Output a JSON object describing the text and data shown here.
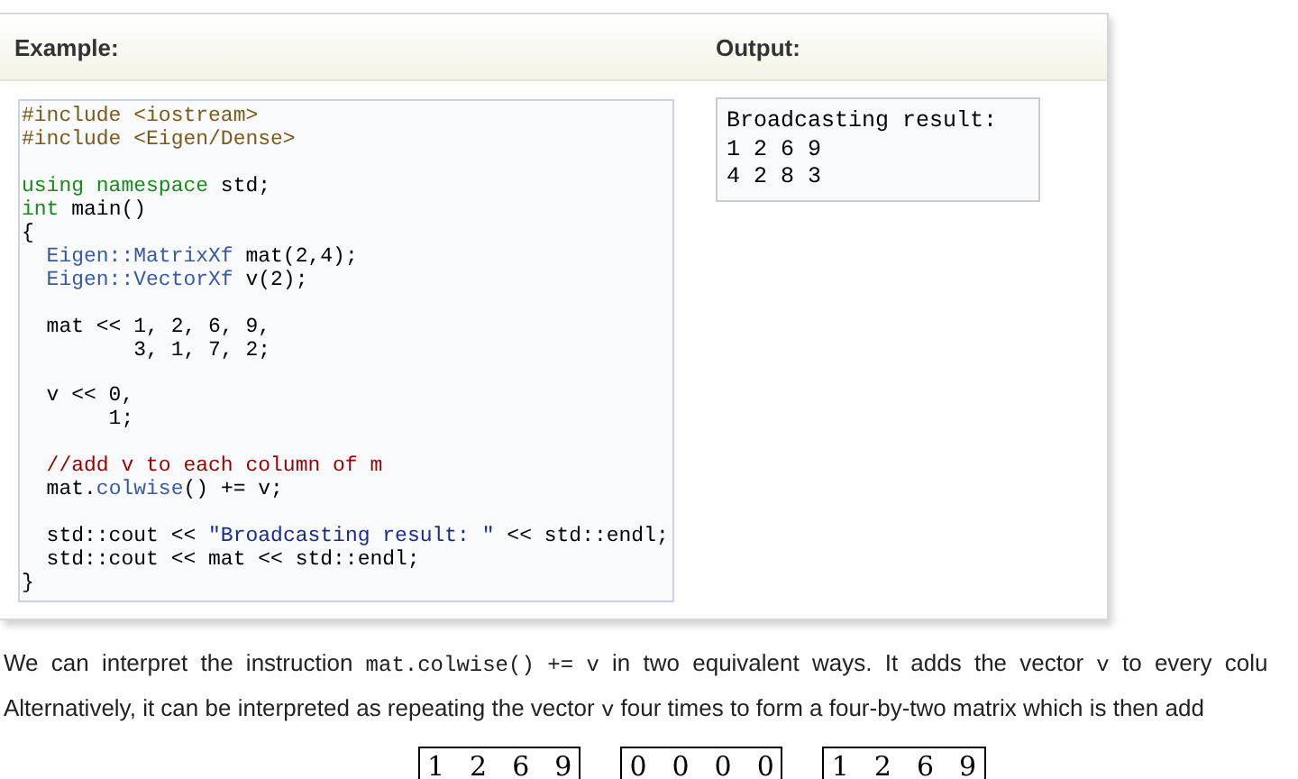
{
  "example": {
    "title": "Example:",
    "code_blocks": [
      [
        [
          {
            "kind": "preproc",
            "text": "#include <iostream>"
          }
        ],
        [
          {
            "kind": "preproc",
            "text": "#include <Eigen/Dense>"
          }
        ]
      ],
      [
        [
          {
            "kind": "keyword",
            "text": "using namespace"
          },
          {
            "kind": "plain",
            "text": " std;"
          }
        ],
        [
          {
            "kind": "keyword",
            "text": "int"
          },
          {
            "kind": "plain",
            "text": " main()"
          }
        ],
        [
          {
            "kind": "plain",
            "text": "{"
          }
        ],
        [
          {
            "kind": "type",
            "text": "  Eigen::MatrixXf"
          },
          {
            "kind": "plain",
            "text": " mat(2,4);"
          }
        ],
        [
          {
            "kind": "type",
            "text": "  Eigen::VectorXf"
          },
          {
            "kind": "plain",
            "text": " v(2);"
          }
        ]
      ],
      [
        [
          {
            "kind": "plain",
            "text": "  mat << 1, 2, 6, 9,"
          }
        ],
        [
          {
            "kind": "plain",
            "text": "         3, 1, 7, 2;"
          }
        ]
      ],
      [
        [
          {
            "kind": "plain",
            "text": "  v << 0,"
          }
        ],
        [
          {
            "kind": "plain",
            "text": "       1;"
          }
        ]
      ],
      [
        [
          {
            "kind": "comment",
            "text": "  //add v to each column of m"
          }
        ],
        [
          {
            "kind": "plain",
            "text": "  mat."
          },
          {
            "kind": "type",
            "text": "colwise"
          },
          {
            "kind": "plain",
            "text": "() += v;"
          }
        ]
      ],
      [
        [
          {
            "kind": "plain",
            "text": "  std::cout << "
          },
          {
            "kind": "string",
            "text": "\"Broadcasting result: \""
          },
          {
            "kind": "plain",
            "text": " << std::endl;"
          }
        ],
        [
          {
            "kind": "plain",
            "text": "  std::cout << mat << std::endl;"
          }
        ],
        [
          {
            "kind": "plain",
            "text": "}"
          }
        ]
      ]
    ]
  },
  "output": {
    "title": "Output:",
    "lines": [
      "Broadcasting result:",
      "1 2 6 9",
      "4 2 8 3"
    ]
  },
  "paragraph_lines": [
    [
      {
        "kind": "text",
        "text": "We can interpret the instruction "
      },
      {
        "kind": "code",
        "text": "mat.colwise() += v"
      },
      {
        "kind": "text",
        "text": " in two equivalent ways. It adds the vector "
      },
      {
        "kind": "code",
        "text": "v"
      },
      {
        "kind": "text",
        "text": " to every colu"
      }
    ],
    [
      {
        "kind": "text",
        "text": "Alternatively, it can be interpreted as repeating the vector "
      },
      {
        "kind": "code",
        "text": "v"
      },
      {
        "kind": "text",
        "text": " four times to form a four-by-two matrix which is then add"
      }
    ]
  ],
  "matrices": [
    [
      "1",
      "2",
      "6",
      "9"
    ],
    [
      "0",
      "0",
      "0",
      "0"
    ],
    [
      "1",
      "2",
      "6",
      "9"
    ]
  ]
}
